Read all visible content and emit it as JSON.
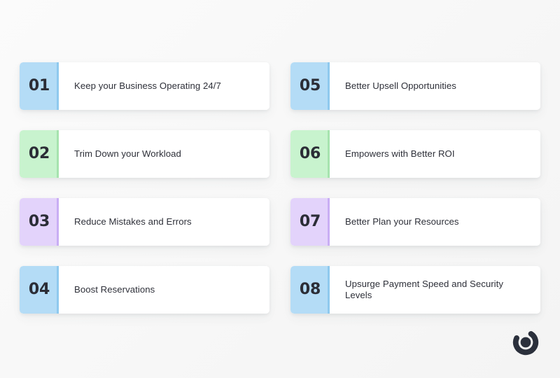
{
  "page": {
    "background_color": "#fafafa",
    "text_color": "#2e3039",
    "number_color": "#2b2d36"
  },
  "cards": [
    {
      "number": "01",
      "label": "Keep your Business Operating 24/7",
      "accent_color": "#b4dcf6",
      "stripe_color": "#8fc9ee",
      "column": "left"
    },
    {
      "number": "02",
      "label": "Trim Down your Workload",
      "accent_color": "#c8f3ce",
      "stripe_color": "#a6e3ae",
      "column": "left"
    },
    {
      "number": "03",
      "label": "Reduce Mistakes and Errors",
      "accent_color": "#e3d3fb",
      "stripe_color": "#c9aef4",
      "column": "left"
    },
    {
      "number": "04",
      "label": "Boost Reservations",
      "accent_color": "#b4dcf6",
      "stripe_color": "#8fc9ee",
      "column": "left"
    },
    {
      "number": "05",
      "label": "Better Upsell Opportunities",
      "accent_color": "#b4dcf6",
      "stripe_color": "#8fc9ee",
      "column": "right"
    },
    {
      "number": "06",
      "label": "Empowers with Better ROI",
      "accent_color": "#c8f3ce",
      "stripe_color": "#a6e3ae",
      "column": "right"
    },
    {
      "number": "07",
      "label": "Better Plan your Resources",
      "accent_color": "#e3d3fb",
      "stripe_color": "#c9aef4",
      "column": "right"
    },
    {
      "number": "08",
      "label": "Upsurge Payment Speed and Security Levels",
      "accent_color": "#b4dcf6",
      "stripe_color": "#8fc9ee",
      "column": "right"
    }
  ],
  "logo": {
    "name": "circle-dot-logo",
    "color": "#2b303c"
  }
}
